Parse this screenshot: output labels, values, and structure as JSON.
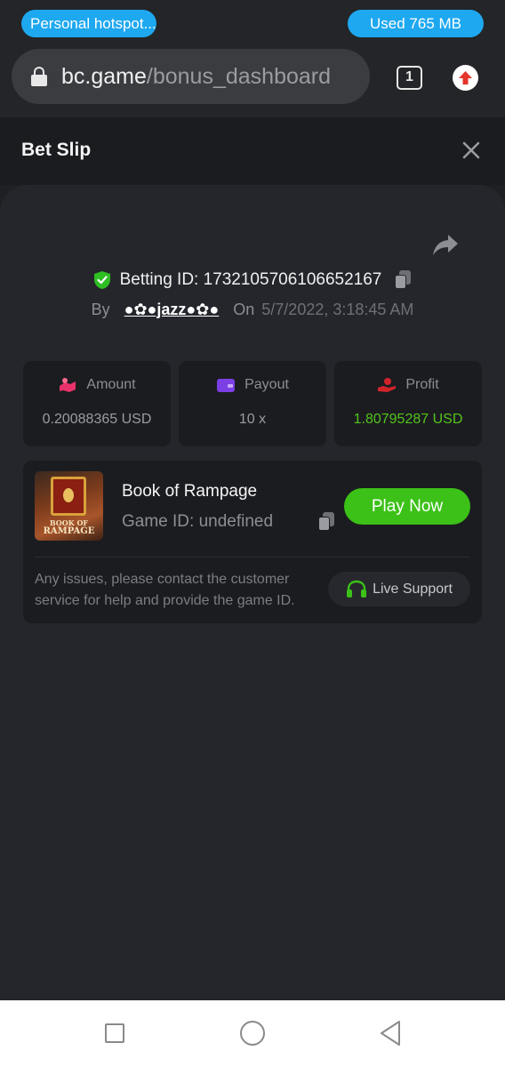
{
  "status_bar": {
    "hotspot_label": "Personal hotspot...",
    "data_usage": "Used  765 MB"
  },
  "browser": {
    "url_domain": "bc.game",
    "url_path": "/bonus_dashboard",
    "tab_count": "1"
  },
  "bet_slip": {
    "title": "Bet Slip",
    "betting_id_label": "Betting ID: 1732105706106652167",
    "by_label": "By",
    "username": "●✿●jazz●✿●",
    "on_label": "On",
    "date": "5/7/2022, 3:18:45 AM",
    "stats": [
      {
        "label": "Amount",
        "value": "0.20088365 USD",
        "icon": "amount-icon",
        "color": "#e8336a"
      },
      {
        "label": "Payout",
        "value": "10 x",
        "icon": "wallet-icon",
        "color": "#7b3fe4"
      },
      {
        "label": "Profit",
        "value": "1.80795287 USD",
        "icon": "profit-hand-icon",
        "color": "#d0242a"
      }
    ],
    "profit_color": "#52c41a"
  },
  "game": {
    "thumb_text_line1": "BOOK OF",
    "thumb_text_line2": "RAMPAGE",
    "title": "Book of Rampage",
    "game_id": "Game ID: undefined",
    "play_label": "Play Now",
    "issue_text": "Any issues, please contact the customer service for help and provide the game ID.",
    "support_label": "Live Support"
  },
  "colors": {
    "accent_green": "#3bc117",
    "pill_blue": "#1ea8f0",
    "background": "#24262b"
  }
}
